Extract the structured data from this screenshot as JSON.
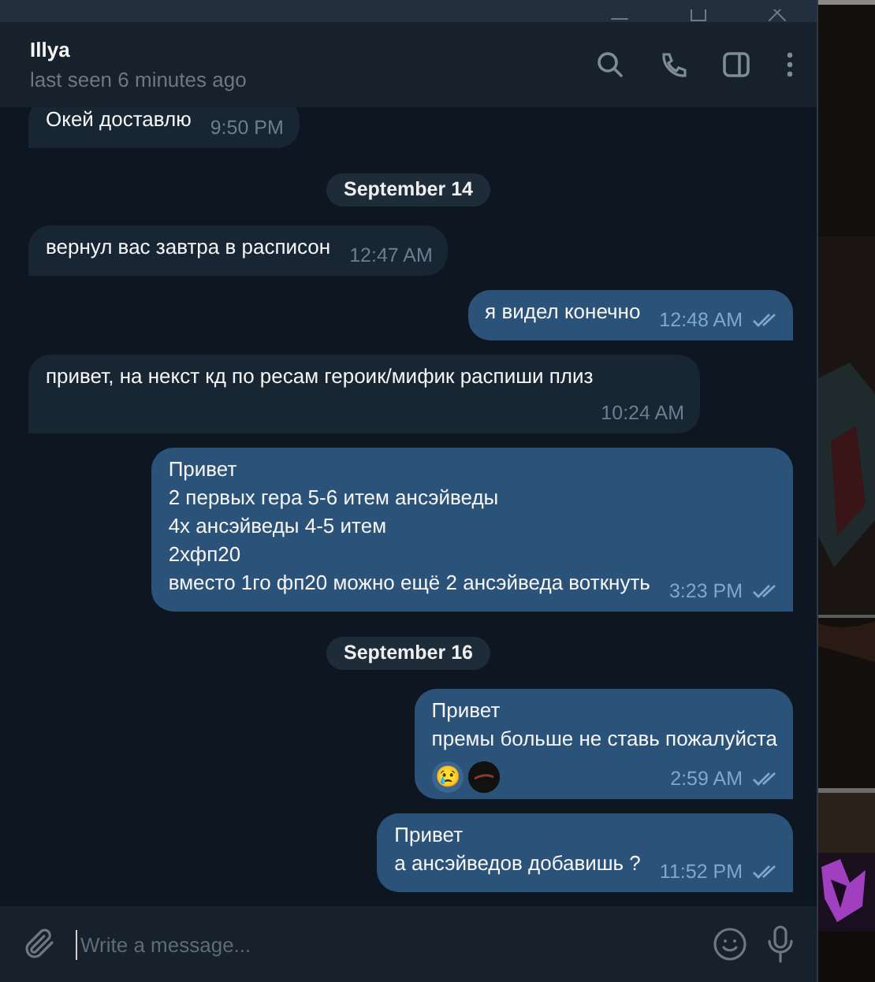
{
  "chat": {
    "name": "Illya",
    "status": "last seen 6 minutes ago"
  },
  "messages": [
    {
      "kind": "message",
      "outgoing": false,
      "text": "Окей доставлю",
      "time": "9:50 PM"
    },
    {
      "kind": "date",
      "text": "September 14"
    },
    {
      "kind": "message",
      "outgoing": false,
      "text": "вернул вас завтра в расписон",
      "time": "12:47 AM"
    },
    {
      "kind": "message",
      "outgoing": true,
      "text": "я видел конечно",
      "time": "12:48 AM",
      "read": true
    },
    {
      "kind": "message",
      "outgoing": false,
      "text": "привет, на некст кд по ресам героик/мифик распиши плиз",
      "time": "10:24 AM"
    },
    {
      "kind": "message",
      "outgoing": true,
      "text": "Привет\n2 первых гера 5-6 итем ансэйведы\n4х ансэйведы 4-5 итем\n2хфп20\nвместо 1го фп20 можно ещё 2 ансэйведа воткнуть",
      "time": "3:23 PM",
      "read": true
    },
    {
      "kind": "date",
      "text": "September 16"
    },
    {
      "kind": "message",
      "outgoing": true,
      "text": "Привет\nпремы больше не ставь пожалуйста",
      "time": "2:59 AM",
      "read": true,
      "reactions": [
        {
          "kind": "emoji",
          "text": "😢"
        },
        {
          "kind": "avatar"
        }
      ]
    },
    {
      "kind": "message",
      "outgoing": true,
      "text": "Привет\nа ансэйведов добавишь ?",
      "time": "11:52 PM",
      "read": true
    }
  ],
  "composer": {
    "placeholder": "Write a message..."
  }
}
